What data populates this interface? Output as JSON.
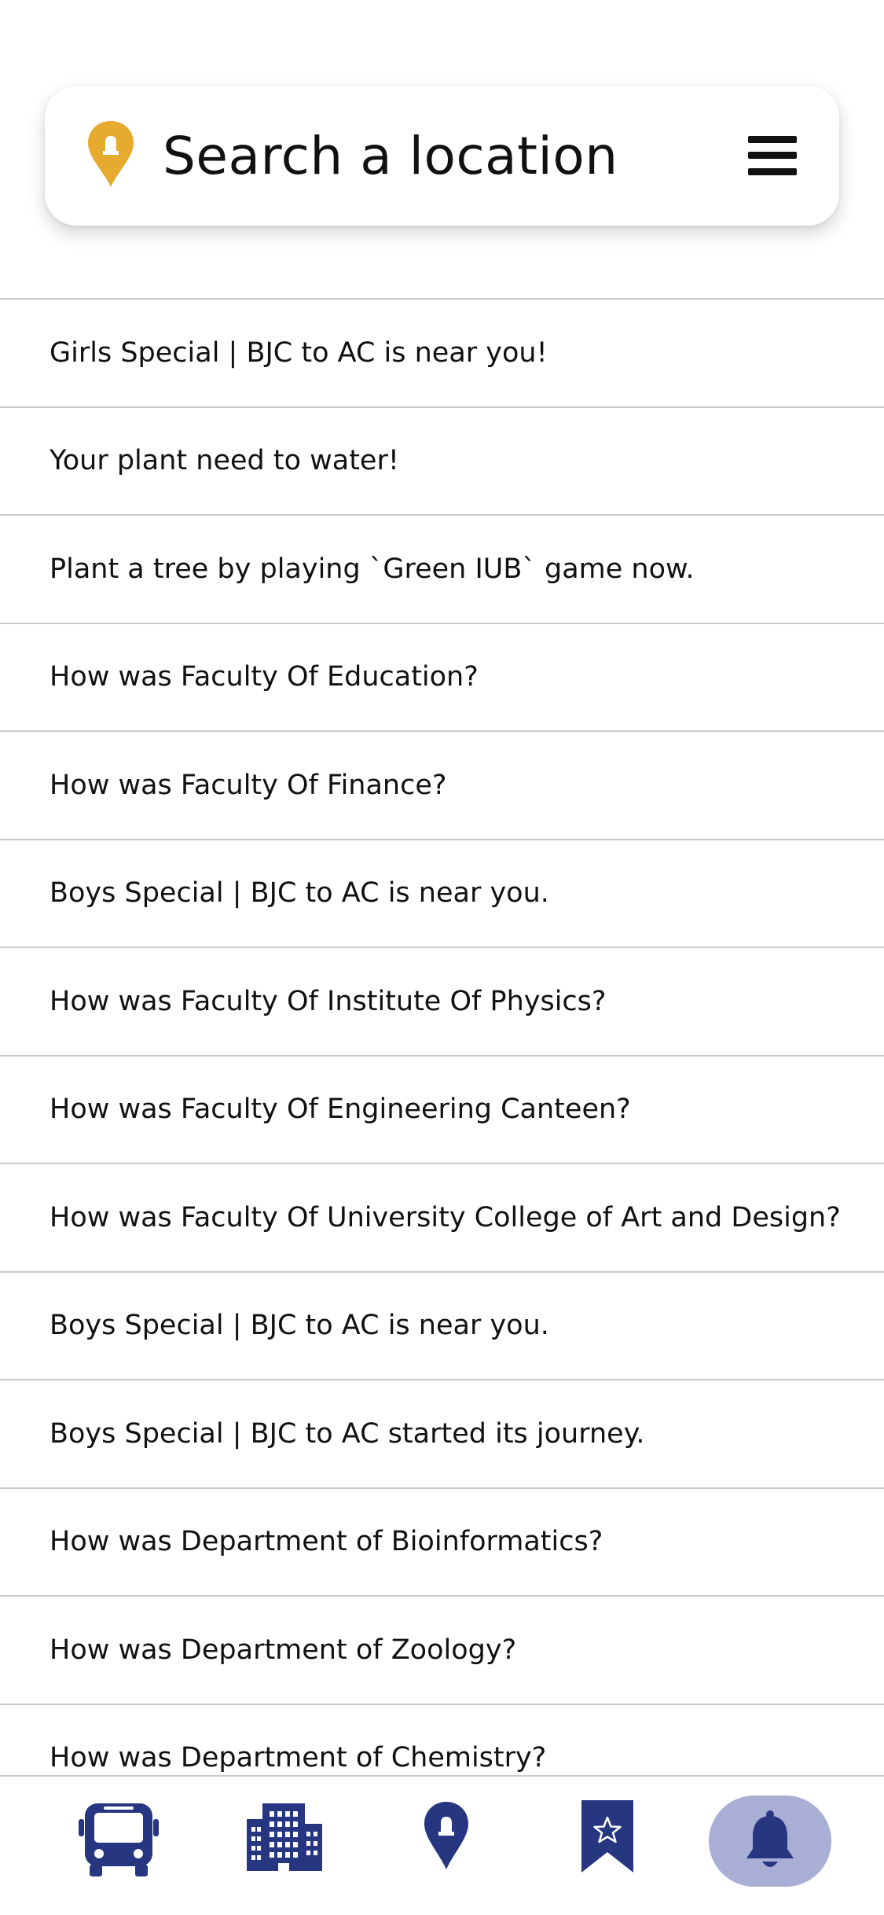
{
  "search": {
    "placeholder": "Search a location"
  },
  "colors": {
    "pin_accent": "#e6ab2e",
    "nav_icon": "#273680",
    "nav_active_bg": "#a9aed5"
  },
  "notifications": [
    "Girls Special | BJC to AC is near you!",
    "Your plant need to water!",
    "Plant a tree by playing `Green IUB` game now.",
    "How was Faculty Of Education?",
    "How was Faculty Of Finance?",
    "Boys Special | BJC to AC is near you.",
    "How was Faculty Of Institute Of Physics?",
    "How was Faculty Of Engineering Canteen?",
    "How was Faculty Of University College of Art and Design?",
    "Boys Special | BJC to AC is near you.",
    "Boys Special | BJC to AC started its journey.",
    "How was Department of Bioinformatics?",
    "How was Department of Zoology?",
    "How was Department of Chemistry?"
  ],
  "bottom_nav": {
    "items": [
      {
        "icon": "bus-icon"
      },
      {
        "icon": "building-icon"
      },
      {
        "icon": "location-pin-icon"
      },
      {
        "icon": "bookmark-star-icon"
      },
      {
        "icon": "bell-icon",
        "active": true
      }
    ]
  }
}
